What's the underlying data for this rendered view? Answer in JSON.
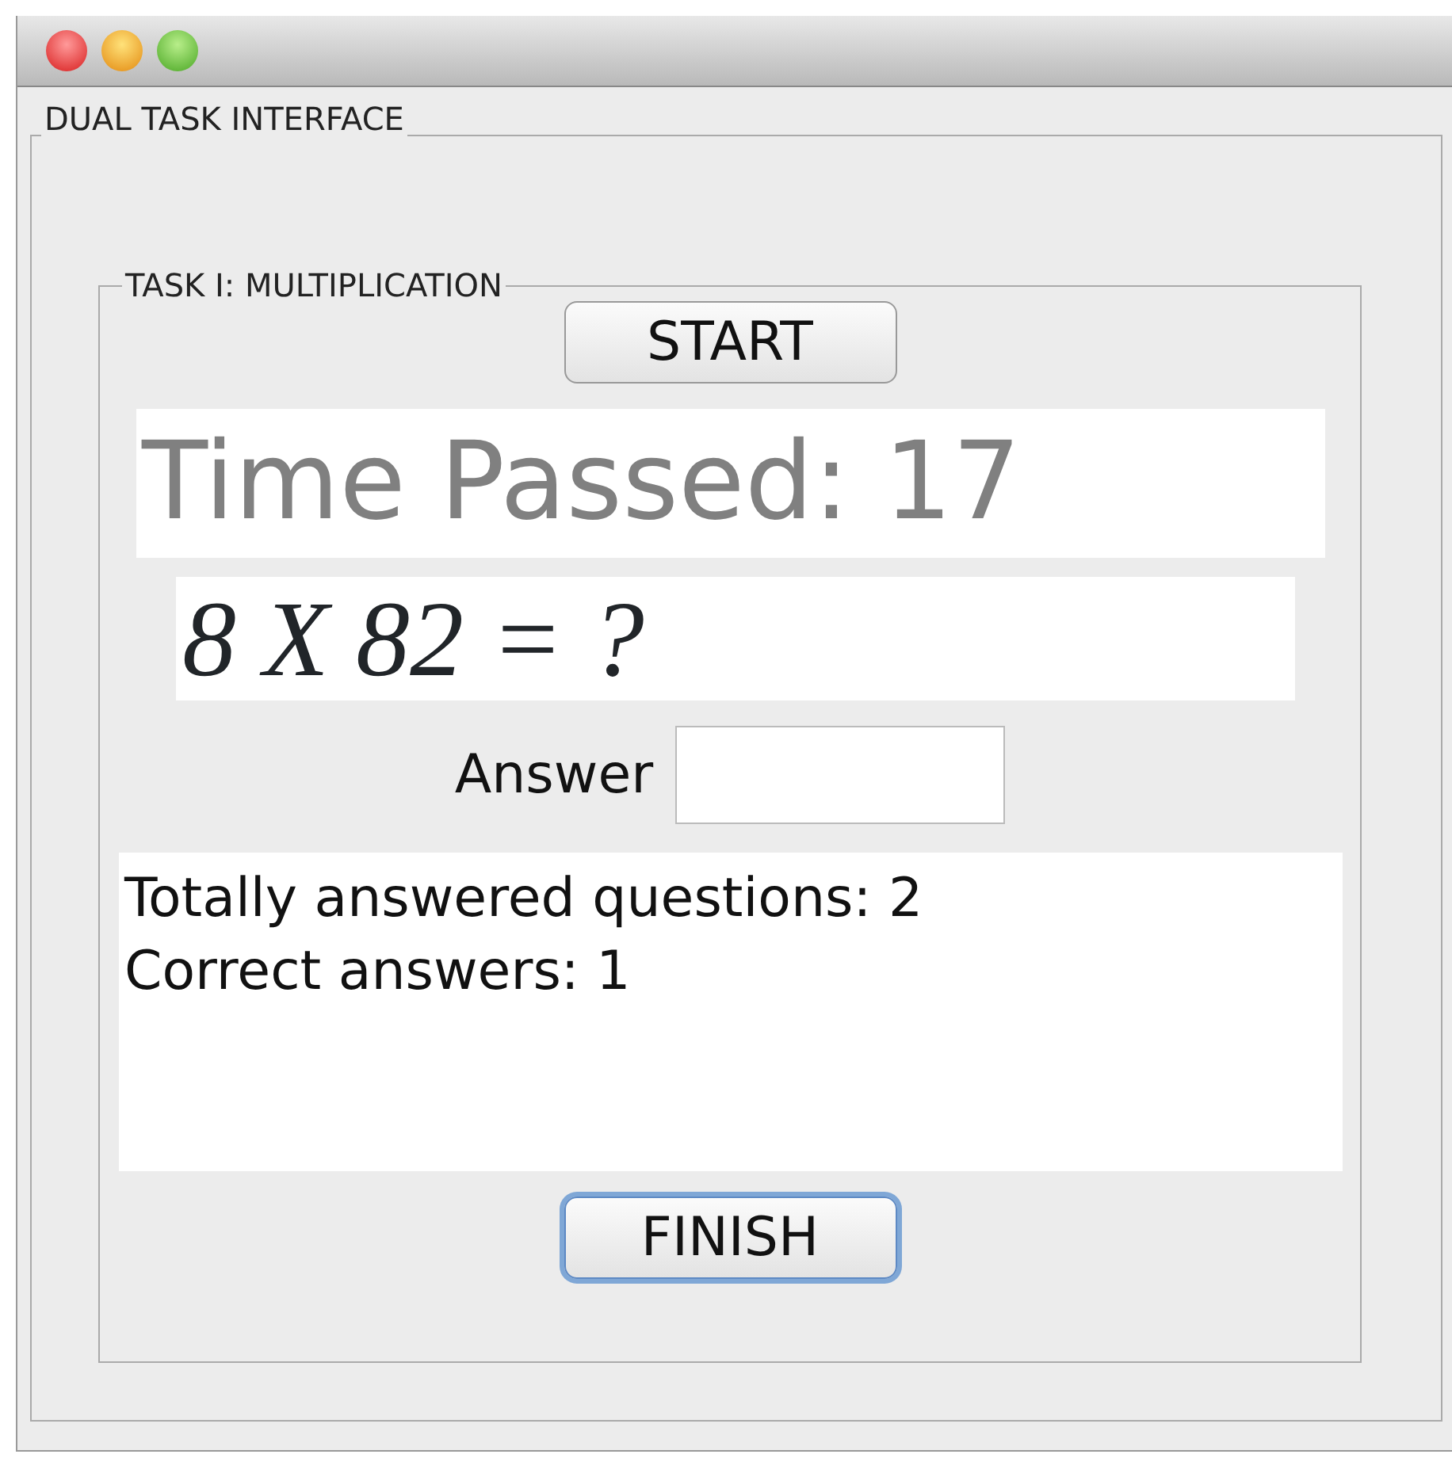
{
  "window": {
    "title": "DUAL TASK INTERFACE"
  },
  "task": {
    "title": "TASK I: MULTIPLICATION",
    "buttons": [
      {
        "label": "START",
        "focused": false
      }
    ],
    "timer": "Time Passed: 17",
    "question": "8 X 82 = ?",
    "answer": {
      "label": "Answer"
    },
    "results": [
      "Totally answered questions: 2",
      "Correct answers: 1"
    ],
    "finish": {
      "label": "FINISH",
      "focused": true
    }
  }
}
